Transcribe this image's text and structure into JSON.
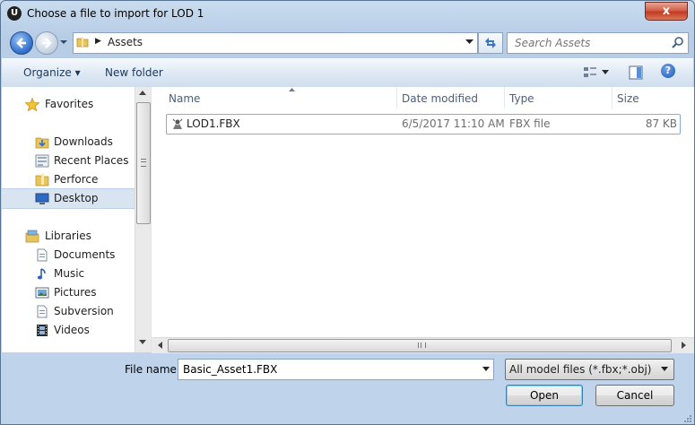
{
  "window": {
    "app_icon_glyph": "U",
    "title": "Choose a file to import for LOD 1",
    "close_glyph": "x"
  },
  "nav": {
    "breadcrumb": "Assets",
    "search_placeholder": "Search Assets"
  },
  "toolbar": {
    "organize": "Organize ▾",
    "new_folder": "New folder",
    "help_glyph": "?"
  },
  "sidebar": {
    "favorites": "Favorites",
    "downloads": "Downloads",
    "recent_places": "Recent Places",
    "perforce": "Perforce",
    "desktop": "Desktop",
    "libraries": "Libraries",
    "documents": "Documents",
    "music": "Music",
    "pictures": "Pictures",
    "subversion": "Subversion",
    "videos": "Videos"
  },
  "columns": {
    "name": "Name",
    "date_modified": "Date modified",
    "type": "Type",
    "size": "Size"
  },
  "files": [
    {
      "name": "LOD1.FBX",
      "date": "6/5/2017 11:10 AM",
      "type": "FBX file",
      "size": "87 KB"
    }
  ],
  "footer": {
    "file_name_label": "File name:",
    "file_name_value": "Basic_Asset1.FBX",
    "file_type": "All model files (*.fbx;*.obj)",
    "open": "Open",
    "cancel": "Cancel"
  },
  "colors": {
    "accent": "#3a78d1",
    "selection": "#d9e4f1",
    "close": "#c23b21"
  }
}
